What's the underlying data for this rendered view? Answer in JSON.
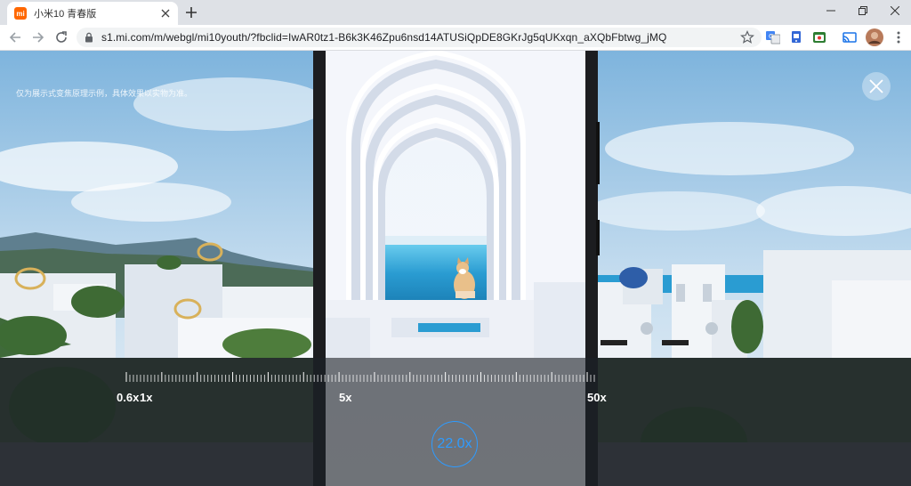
{
  "browser": {
    "tab": {
      "favicon_text": "mi",
      "title": "小米10 青春版"
    },
    "url": "s1.mi.com/m/webgl/mi10youth/?fbclid=IwAR0tz1-B6k3K46Zpu6nsd14ATUSiQpDE8GKrJg5qUKxqn_aXQbFbtwg_jMQ",
    "icons": {
      "back": "arrow-left-icon",
      "forward": "arrow-right-icon",
      "reload": "reload-icon",
      "lock": "lock-icon",
      "bookmark": "star-icon",
      "new_tab": "plus-icon",
      "extensions": [
        "translate-icon",
        "extension-icon",
        "extension-icon",
        "cast-icon"
      ],
      "profile": "avatar",
      "menu": "kebab-menu-icon"
    }
  },
  "page": {
    "disclaimer": "仅为展示式变焦原理示例，具体效果以实物为准。",
    "zoom": {
      "labels": [
        "0.6x",
        "1x",
        "5x",
        "50x"
      ],
      "current": "22.0x",
      "accent_color": "#2e9bff"
    }
  }
}
